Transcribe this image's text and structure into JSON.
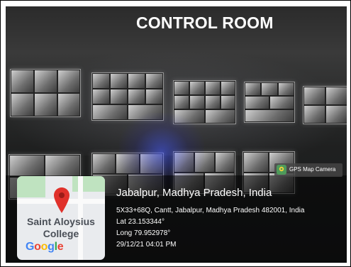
{
  "photo": {
    "title": "CONTROL ROOM"
  },
  "badge": {
    "label": "GPS Map Camera",
    "icon": "gps-map-camera-icon"
  },
  "map": {
    "place_line1": "Saint Aloysius",
    "place_line2": "College",
    "brand": "Google",
    "pin_color": "#e0312b",
    "pin_icon": "map-pin-icon"
  },
  "location": {
    "city": "Jabalpur, Madhya Pradesh, India",
    "address": "5X33+68Q, Cantt, Jabalpur, Madhya Pradesh 482001, India",
    "lat": "Lat 23.153344°",
    "long": "Long 79.952978°",
    "datetime": "29/12/21 04:01 PM"
  }
}
